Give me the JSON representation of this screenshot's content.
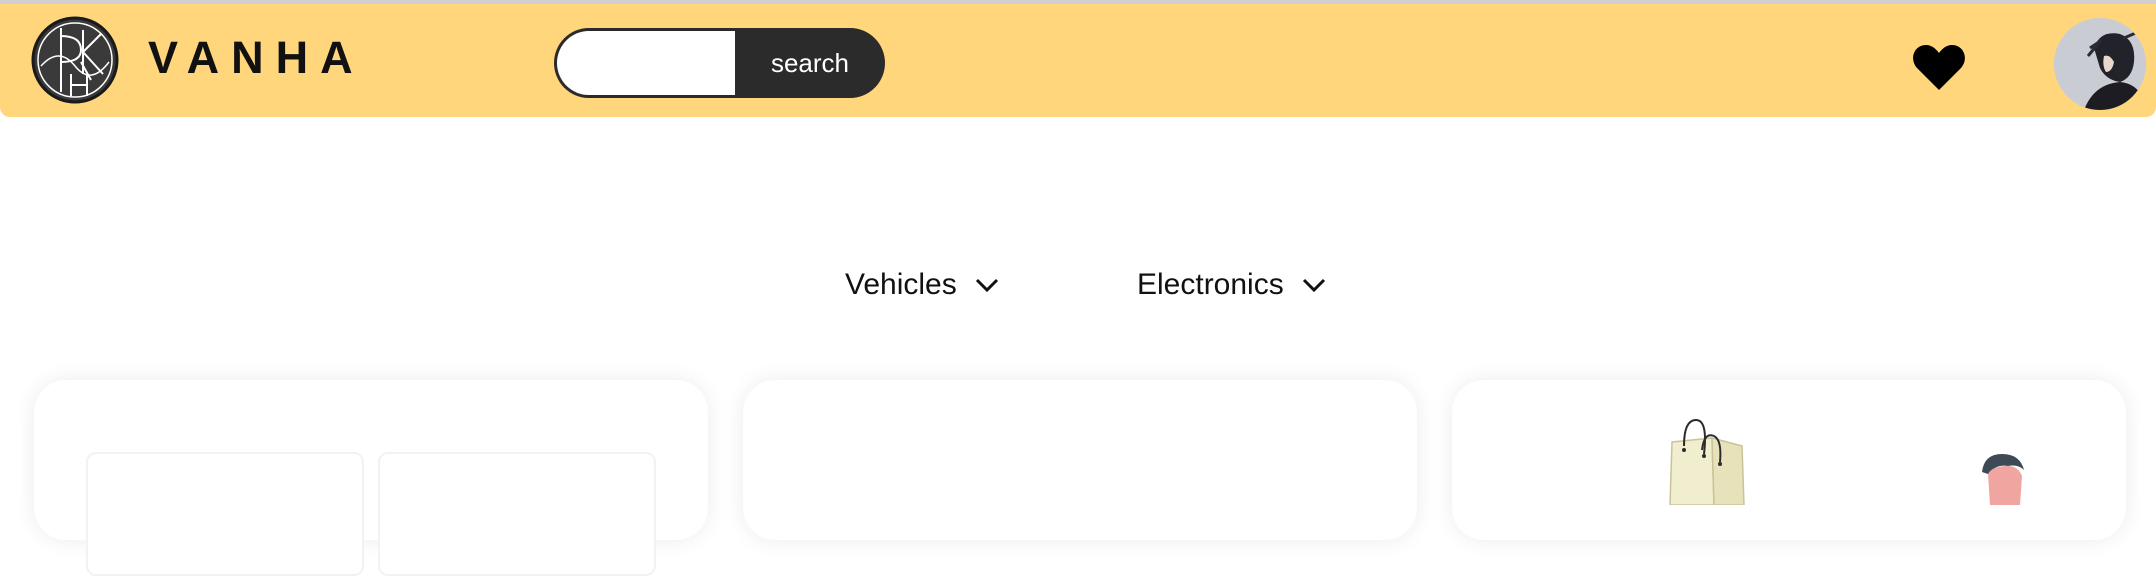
{
  "header": {
    "brand": "VANHA",
    "search": {
      "placeholder": "",
      "value": "",
      "button_label": "search"
    },
    "icons": {
      "logo": "logo-icon",
      "favorites": "heart-icon",
      "avatar": "user-avatar"
    },
    "accent_color": "#ffd67c",
    "dark_color": "#2b2b2b"
  },
  "categories": [
    {
      "label": "Vehicles",
      "icon": "chevron-down-icon"
    },
    {
      "label": "Electronics",
      "icon": "chevron-down-icon"
    }
  ],
  "cards": [
    {
      "name": "card-1"
    },
    {
      "name": "card-2"
    },
    {
      "name": "card-3",
      "illustration": "shopping-bag-illustration"
    }
  ]
}
